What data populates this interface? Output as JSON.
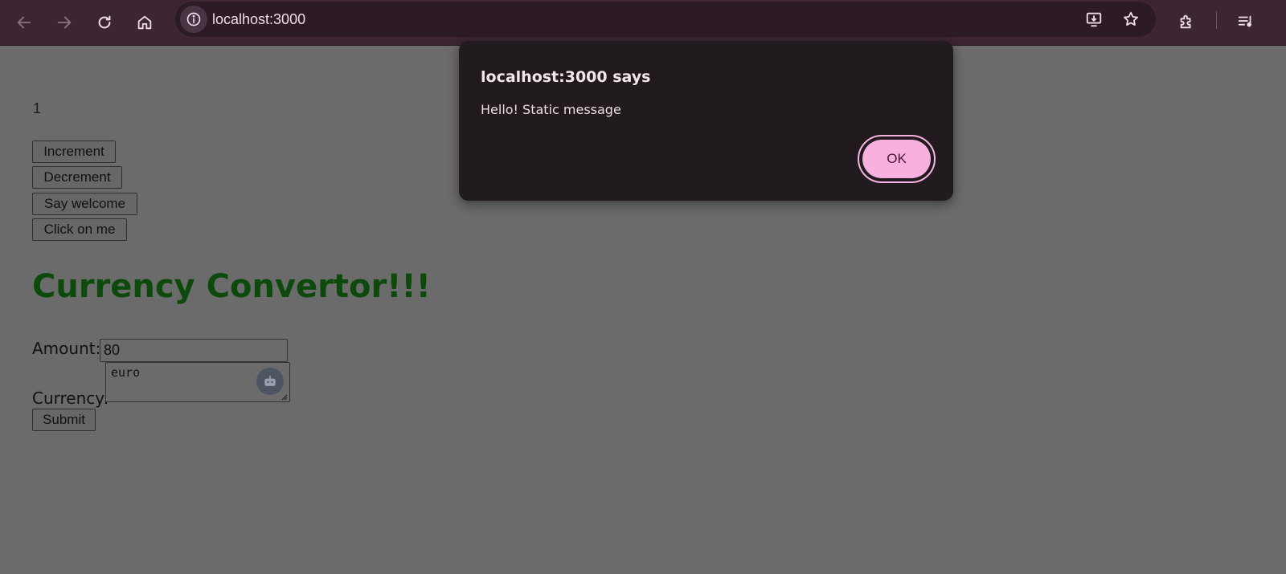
{
  "browser": {
    "url": "localhost:3000",
    "icons": {
      "back": "arrow-left-icon",
      "forward": "arrow-right-icon",
      "reload": "reload-icon",
      "home": "home-icon",
      "site_info": "info-icon",
      "install": "install-app-icon",
      "bookmark": "star-icon",
      "extensions": "puzzle-icon",
      "media": "media-queue-icon"
    }
  },
  "page": {
    "counter": "1",
    "buttons": {
      "increment": "Increment",
      "decrement": "Decrement",
      "say_welcome": "Say welcome",
      "click_on_me": "Click on me",
      "submit": "Submit"
    },
    "heading": "Currency Convertor!!!",
    "form": {
      "amount_label": "Amount:",
      "amount_value": "80",
      "currency_label": "Currency:",
      "currency_value": "euro"
    }
  },
  "dialog": {
    "title": "localhost:3000 says",
    "message": "Hello! Static message",
    "ok_label": "OK"
  },
  "colors": {
    "toolbar_bg": "#3d2534",
    "overlay_page_bg": "#6b6b6b",
    "heading": "#0c4a0c",
    "dialog_bg": "#211a1e",
    "ok_button": "#f8b0de"
  }
}
